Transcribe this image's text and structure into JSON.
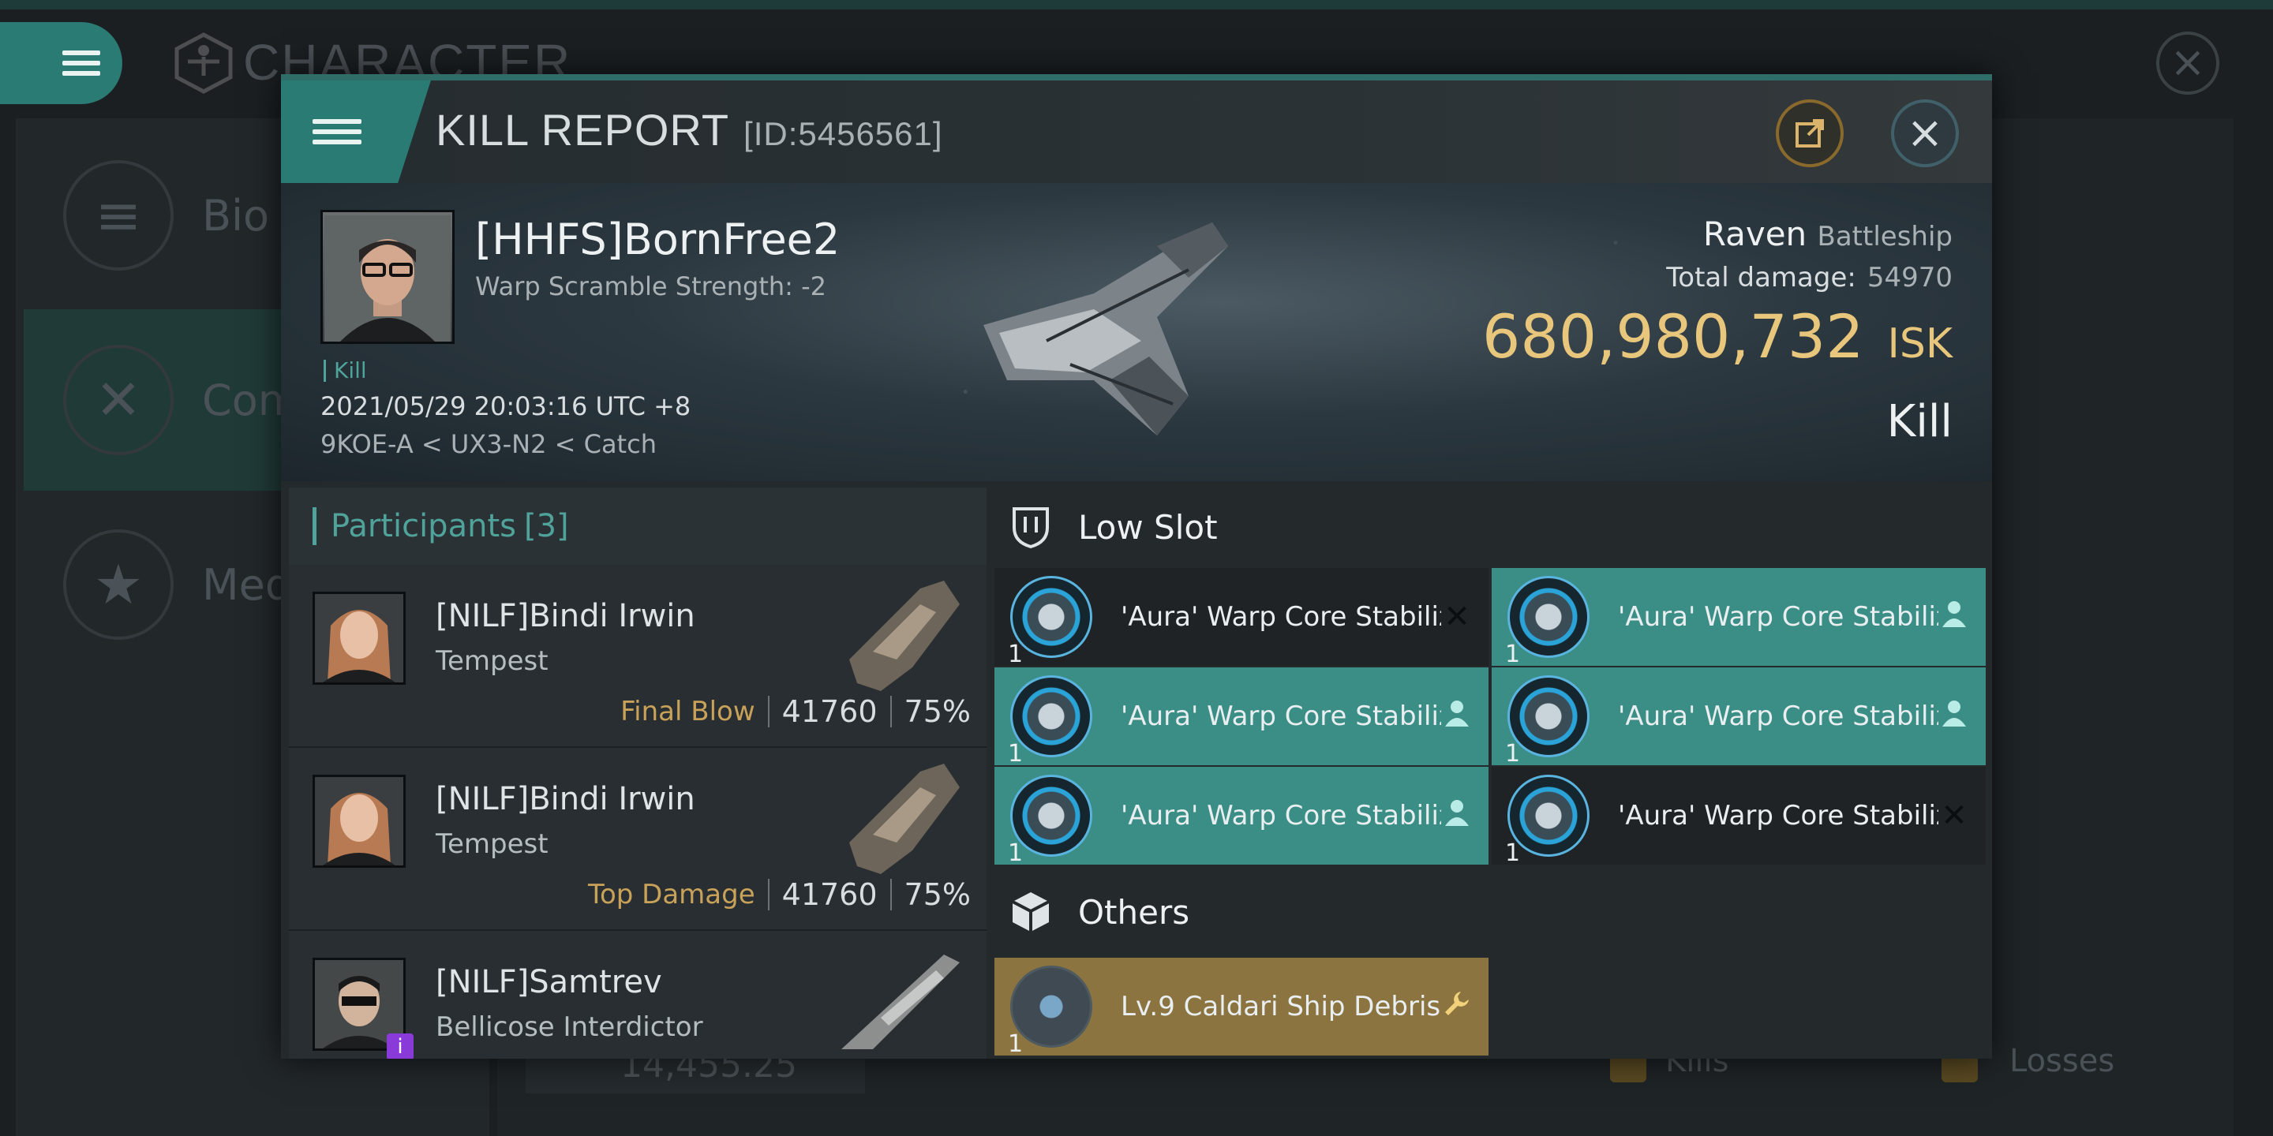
{
  "background": {
    "title": "CHARACTER",
    "sidebar": [
      {
        "label": "Bio",
        "icon": "list-icon"
      },
      {
        "label": "Com",
        "icon": "swords-icon"
      },
      {
        "label": "Meda",
        "icon": "star-icon"
      }
    ],
    "wallet": "14,455.25",
    "kills_label": "Kills",
    "losses_label": "Losses"
  },
  "report": {
    "title": "KILL REPORT",
    "id": "[ID:5456561]",
    "victim": {
      "name": "[HHFS]BornFree2",
      "warp_scramble": "Warp Scramble Strength: -2",
      "tag": "Kill",
      "timestamp": "2021/05/29 20:03:16 UTC +8",
      "location": "9KOE-A < UX3-N2 < Catch",
      "ship_name": "Raven",
      "ship_class": "Battleship",
      "total_damage_label": "Total damage:",
      "total_damage": "54970",
      "isk_value": "680,980,732",
      "isk_unit": "ISK",
      "result": "Kill"
    },
    "participants": {
      "label": "Participants",
      "count": "[3]",
      "items": [
        {
          "name": "[NILF]Bindi Irwin",
          "ship": "Tempest",
          "role": "Final Blow",
          "damage": "41760",
          "percent": "75%"
        },
        {
          "name": "[NILF]Bindi Irwin",
          "ship": "Tempest",
          "role": "Top Damage",
          "damage": "41760",
          "percent": "75%"
        },
        {
          "name": "[NILF]Samtrev",
          "ship": "Bellicose Interdictor",
          "badge": "i"
        }
      ]
    },
    "low_slot": {
      "label": "Low Slot",
      "items": [
        {
          "name": "'Aura' Warp Core Stabilizer",
          "qty": "1",
          "state": "destroyed",
          "flag_icon": "x-icon"
        },
        {
          "name": "'Aura' Warp Core Stabilizer",
          "qty": "1",
          "state": "dropped",
          "flag_icon": "person-icon"
        },
        {
          "name": "'Aura' Warp Core Stabilizer",
          "qty": "1",
          "state": "dropped",
          "flag_icon": "person-icon"
        },
        {
          "name": "'Aura' Warp Core Stabilizer",
          "qty": "1",
          "state": "dropped",
          "flag_icon": "person-icon"
        },
        {
          "name": "'Aura' Warp Core Stabilizer",
          "qty": "1",
          "state": "dropped",
          "flag_icon": "person-icon"
        },
        {
          "name": "'Aura' Warp Core Stabilizer",
          "qty": "1",
          "state": "destroyed",
          "flag_icon": "x-icon"
        }
      ]
    },
    "others": {
      "label": "Others",
      "items": [
        {
          "name": "Lv.9 Caldari Ship Debris",
          "qty": "1",
          "flag_icon": "wrench-icon"
        }
      ]
    }
  },
  "colors": {
    "accent": "#2a7b73",
    "isk": "#e8c77c",
    "dropped_item": "#3a8e85",
    "destroyed_item": "#1f2326",
    "salvage_item": "#8b7440"
  }
}
